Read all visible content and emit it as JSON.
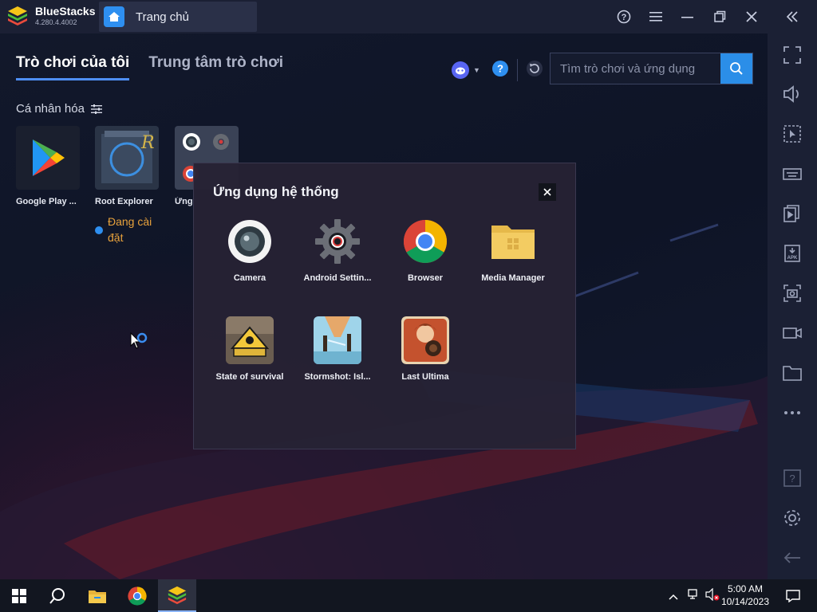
{
  "app": {
    "name": "BlueStacks",
    "version": "4.280.4.4002",
    "tab_label": "Trang chủ"
  },
  "window_controls": [
    "help-icon",
    "menu-icon",
    "minimize-icon",
    "restore-icon",
    "close-icon",
    "collapse-icon"
  ],
  "tabs": [
    {
      "label": "Trò chơi của tôi",
      "active": true
    },
    {
      "label": "Trung tâm trò chơi",
      "active": false
    }
  ],
  "search": {
    "placeholder": "Tìm trò chơi và ứng dụng"
  },
  "section_title": "Cá nhân hóa",
  "apps": [
    {
      "name": "Google Play ...",
      "icon": "google-play-icon"
    },
    {
      "name": "Root Explorer",
      "icon": "root-explorer-icon"
    },
    {
      "name": "Ứng",
      "icon": "system-apps-folder-icon"
    }
  ],
  "install_status": "Đang cài đặt",
  "dialog": {
    "title": "Ứng dụng hệ thống",
    "apps": [
      {
        "name": "Camera",
        "icon": "camera-icon"
      },
      {
        "name": "Android Settin...",
        "icon": "settings-gear-icon"
      },
      {
        "name": "Browser",
        "icon": "chrome-icon"
      },
      {
        "name": "Media Manager",
        "icon": "folder-icon"
      },
      {
        "name": "State of survival",
        "icon": "state-of-survival-icon"
      },
      {
        "name": "Stormshot: Isl...",
        "icon": "stormshot-icon"
      },
      {
        "name": "Last Ultima",
        "icon": "last-ultima-icon"
      }
    ]
  },
  "sidebar_icons": [
    "fullscreen-icon",
    "volume-icon",
    "pointer-icon",
    "keyboard-icon",
    "multi-instance-icon",
    "apk-install-icon",
    "screenshot-icon",
    "record-icon",
    "folder-icon",
    "more-icon",
    "help-icon",
    "settings-icon",
    "back-icon"
  ],
  "taskbar": {
    "time": "5:00 AM",
    "date": "10/14/2023",
    "items": [
      "windows-start-icon",
      "search-icon",
      "file-explorer-icon",
      "chrome-icon",
      "bluestacks-icon"
    ]
  },
  "colors": {
    "accent": "#2b8ee8",
    "install": "#e8a23c",
    "sidebar": "#1b2034"
  }
}
